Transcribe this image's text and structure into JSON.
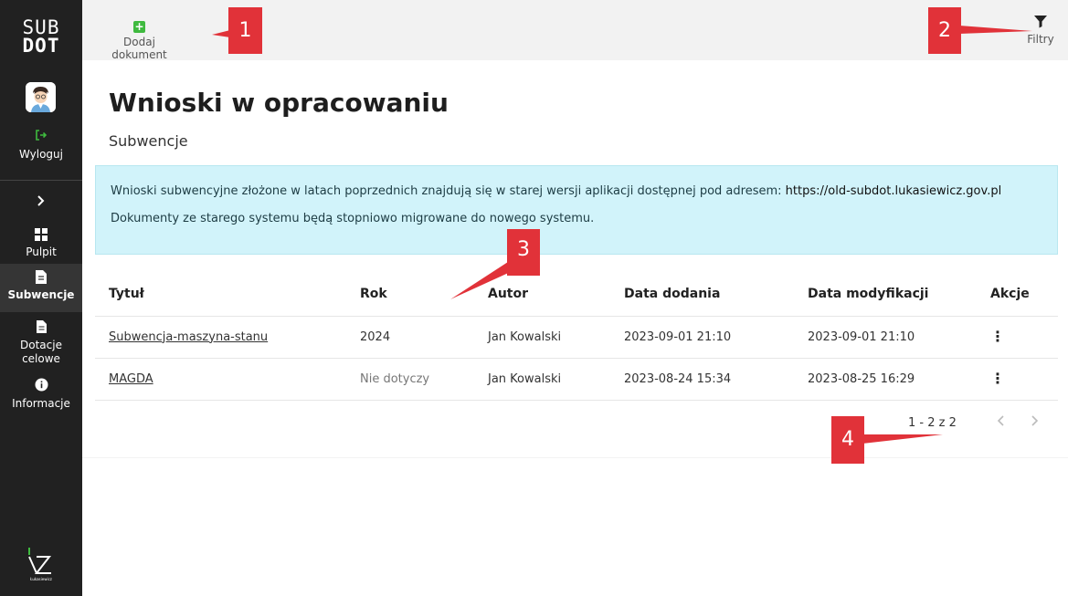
{
  "sidebar": {
    "logo_line1": "SUB",
    "logo_line2": "DOT",
    "logout_label": "Wyloguj",
    "items": [
      {
        "label_line1": "Pulpit",
        "label_line2": ""
      },
      {
        "label_line1": "Subwencje",
        "label_line2": ""
      },
      {
        "label_line1": "Dotacje",
        "label_line2": "celowe"
      },
      {
        "label_line1": "Informacje",
        "label_line2": ""
      }
    ],
    "brand_text": "Łukasiewicz"
  },
  "topbar": {
    "add_document_label": "Dodaj dokument",
    "filters_label": "Filtry"
  },
  "page": {
    "title": "Wnioski w opracowaniu",
    "subtitle": "Subwencje"
  },
  "notice": {
    "line1": "Wnioski subwencyjne złożone w latach poprzednich znajdują się w starej wersji aplikacji dostępnej pod adresem:",
    "url": "https://old-subdot.lukasiewicz.gov.pl",
    "line2": "Dokumenty ze starego systemu będą stopniowo migrowane do nowego systemu."
  },
  "table": {
    "columns": [
      "Tytuł",
      "Rok",
      "Autor",
      "Data dodania",
      "Data modyfikacji",
      "Akcje"
    ],
    "rows": [
      {
        "title": "Subwencja-maszyna-stanu",
        "year": "2024",
        "author": "Jan Kowalski",
        "added": "2023-09-01 21:10",
        "modified": "2023-09-01 21:10"
      },
      {
        "title": "MAGDA",
        "year": "Nie dotyczy",
        "author": "Jan Kowalski",
        "added": "2023-08-24 15:34",
        "modified": "2023-08-25 16:29"
      }
    ]
  },
  "pagination": {
    "range_text": "1 - 2 z 2"
  },
  "annotations": [
    "1",
    "2",
    "3",
    "4"
  ],
  "colors": {
    "sidebar_bg": "#212121",
    "accent_green": "#3fba3f",
    "notice_bg": "#d1f3fa",
    "annotation_red": "#e13239"
  }
}
